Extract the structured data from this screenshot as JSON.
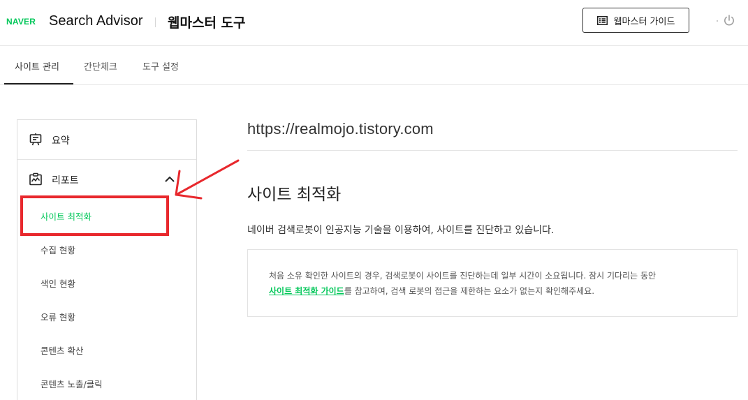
{
  "header": {
    "logo": "NAVER",
    "brand": "Search Advisor",
    "tool_title": "웹마스터 도구",
    "guide_button": "웹마스터 가이드"
  },
  "tabs": [
    {
      "label": "사이트 관리",
      "active": true
    },
    {
      "label": "간단체크",
      "active": false
    },
    {
      "label": "도구 설정",
      "active": false
    }
  ],
  "sidebar": {
    "summary": {
      "label": "요약",
      "icon": "easel-icon"
    },
    "report": {
      "label": "리포트",
      "icon": "report-chart-icon",
      "expanded": true,
      "items": [
        {
          "label": "사이트 최적화",
          "active": true
        },
        {
          "label": "수집 현황",
          "active": false
        },
        {
          "label": "색인 현황",
          "active": false
        },
        {
          "label": "오류 현황",
          "active": false
        },
        {
          "label": "콘텐츠 확산",
          "active": false
        },
        {
          "label": "콘텐츠 노출/클릭",
          "active": false
        }
      ]
    }
  },
  "main": {
    "site_url": "https://realmojo.tistory.com",
    "section_title": "사이트 최적화",
    "description": "네이버 검색로봇이 인공지능 기술을 이용하여, 사이트를 진단하고 있습니다.",
    "notice": {
      "line1": "처음 소유 확인한 사이트의 경우, 검색로봇이 사이트를 진단하는데 일부 시간이 소요됩니다. 잠시 기다리는 동안",
      "link": "사이트 최적화 가이드",
      "line2_rest": "를 참고하여, 검색 로봇의 접근을 제한하는 요소가 없는지 확인해주세요."
    }
  },
  "colors": {
    "brand_green": "#03c75a",
    "annotation_red": "#e8282d"
  }
}
